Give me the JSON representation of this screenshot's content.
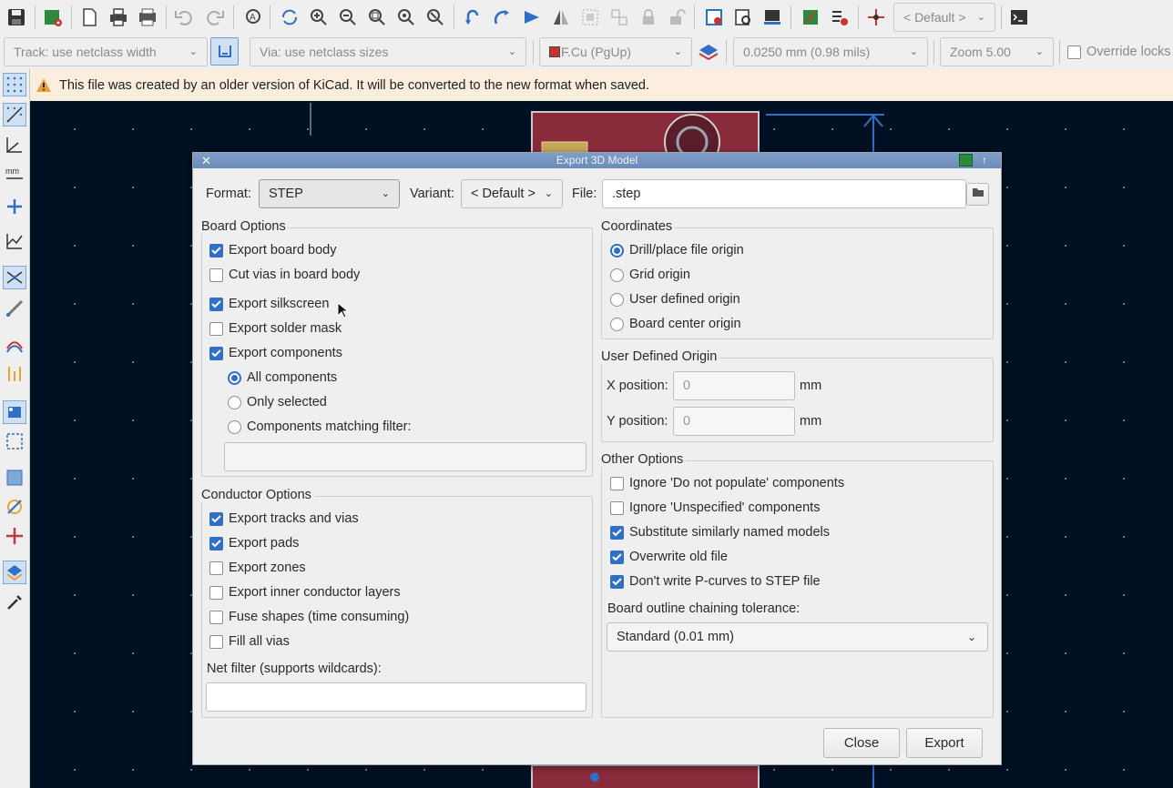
{
  "toolbar": {
    "track_width": "Track: use netclass width",
    "via_size": "Via: use netclass sizes",
    "layer": "F.Cu (PgUp)",
    "layer_color": "#c83232",
    "grid": "0.0250 mm (0.98 mils)",
    "zoom": "Zoom 5.00",
    "variant": "< Default >",
    "override_locks": "Override locks"
  },
  "infobar": {
    "message": "This file was created by an older version of KiCad. It will be converted to the new format when saved."
  },
  "dialog": {
    "title": "Export 3D Model",
    "format_label": "Format:",
    "format_value": "STEP",
    "variant_label": "Variant:",
    "variant_value": "< Default >",
    "file_label": "File:",
    "file_value": ".step",
    "board_options": {
      "title": "Board Options",
      "items": [
        {
          "label": "Export board body",
          "checked": true
        },
        {
          "label": "Cut vias in board body",
          "checked": false
        },
        {
          "label": "Export silkscreen",
          "checked": true
        },
        {
          "label": "Export solder mask",
          "checked": false
        },
        {
          "label": "Export components",
          "checked": true
        }
      ],
      "component_radios": [
        {
          "label": "All components",
          "selected": true
        },
        {
          "label": "Only selected",
          "selected": false
        },
        {
          "label": "Components matching filter:",
          "selected": false
        }
      ],
      "filter_value": ""
    },
    "conductor_options": {
      "title": "Conductor Options",
      "items": [
        {
          "label": "Export tracks and vias",
          "checked": true
        },
        {
          "label": "Export pads",
          "checked": true
        },
        {
          "label": "Export zones",
          "checked": false
        },
        {
          "label": "Export inner conductor layers",
          "checked": false
        },
        {
          "label": "Fuse shapes (time consuming)",
          "checked": false
        },
        {
          "label": "Fill all vias",
          "checked": false
        }
      ],
      "net_filter_label": "Net filter (supports wildcards):",
      "net_filter_value": ""
    },
    "coordinates": {
      "title": "Coordinates",
      "options": [
        {
          "label": "Drill/place file origin",
          "selected": true
        },
        {
          "label": "Grid origin",
          "selected": false
        },
        {
          "label": "User defined origin",
          "selected": false
        },
        {
          "label": "Board center origin",
          "selected": false
        }
      ]
    },
    "user_origin": {
      "title": "User Defined Origin",
      "x_label": "X position:",
      "x_placeholder": "0",
      "y_label": "Y position:",
      "y_placeholder": "0",
      "unit": "mm"
    },
    "other_options": {
      "title": "Other Options",
      "items": [
        {
          "label": "Ignore 'Do not populate' components",
          "checked": false
        },
        {
          "label": "Ignore 'Unspecified' components",
          "checked": false
        },
        {
          "label": "Substitute similarly named models",
          "checked": true
        },
        {
          "label": "Overwrite old file",
          "checked": true
        },
        {
          "label": "Don't write P-curves to STEP file",
          "checked": true
        }
      ],
      "tolerance_label": "Board outline chaining tolerance:",
      "tolerance_value": "Standard (0.01 mm)"
    },
    "close_label": "Close",
    "export_label": "Export"
  }
}
